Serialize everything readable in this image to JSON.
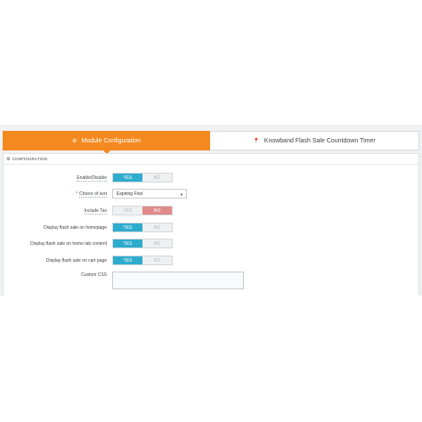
{
  "tabs": [
    {
      "label": "Module Configuration",
      "icon": "gear-icon",
      "active": true
    },
    {
      "label": "Knowband Flash Sale Countdown Timer",
      "icon": "pin-icon",
      "active": false
    }
  ],
  "panel": {
    "title": "CONFIGURATION",
    "icon": "gears-icon"
  },
  "fields": {
    "enable": {
      "label": "Enable/Disable",
      "yes": "YES",
      "no": "NO",
      "value": "YES"
    },
    "sort": {
      "label": "Choice of sort",
      "value": "Expiring First",
      "required": "*"
    },
    "tax": {
      "label": "Include Tax",
      "yes": "YES",
      "no": "NO",
      "value": "NO"
    },
    "homepage": {
      "label": "Display flash sale on homepage",
      "yes": "YES",
      "no": "NO",
      "value": "YES"
    },
    "hometab": {
      "label": "Display flash sale on home tab content",
      "yes": "YES",
      "no": "NO",
      "value": "YES"
    },
    "cart": {
      "label": "Display flash sale on cart page",
      "yes": "YES",
      "no": "NO",
      "value": "YES"
    },
    "css": {
      "label": "Custom CSS",
      "value": ""
    }
  },
  "colors": {
    "accent": "#f4891f",
    "yes_active": "#2eacce",
    "no_active": "#e08a8a"
  }
}
